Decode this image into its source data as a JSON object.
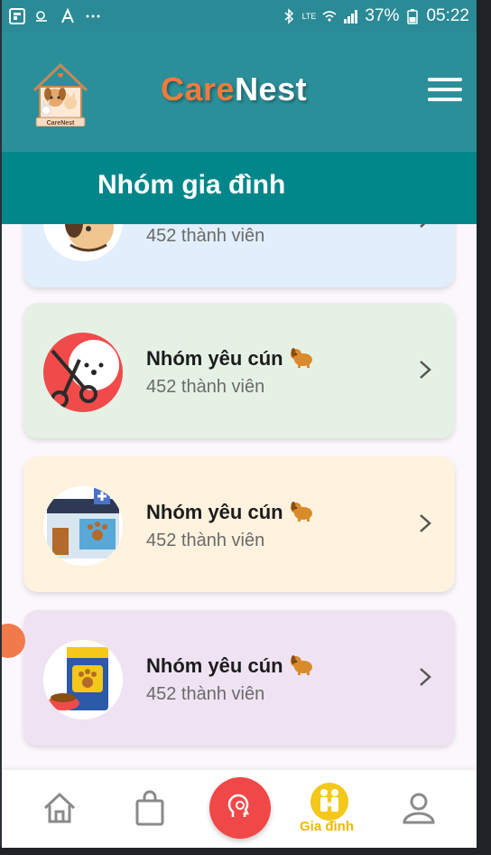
{
  "status_bar": {
    "battery": "37%",
    "time": "05:22",
    "network": "LTE"
  },
  "header": {
    "brand_care": "Care",
    "brand_nest": "Nest",
    "logo_text": "CareNest",
    "title": "Nhóm gia đình"
  },
  "groups": [
    {
      "name": "",
      "count": "452 thành viên",
      "bg": "#e1eefb",
      "avatar": "dog-portrait-icon"
    },
    {
      "name": "Nhóm yêu cún",
      "count": "452 thành viên",
      "bg": "#e6f1e6",
      "avatar": "grooming-scissors-icon"
    },
    {
      "name": "Nhóm yêu cún",
      "count": "452 thành viên",
      "bg": "#fff2de",
      "avatar": "pet-clinic-icon"
    },
    {
      "name": "Nhóm yêu cún",
      "count": "452 thành viên",
      "bg": "#efe3f3",
      "avatar": "pet-food-bag-icon"
    }
  ],
  "bottom_nav": {
    "active_label": "Gia đình",
    "items": [
      "home-icon",
      "shopping-bag-icon",
      "brain-icon",
      "family-icon",
      "user-icon"
    ]
  },
  "colors": {
    "header": "#2b8f99",
    "titlebar": "#01868a",
    "brand_orange": "#f27a3d",
    "fab_red": "#f04848",
    "active_yellow": "#f3c81a"
  }
}
